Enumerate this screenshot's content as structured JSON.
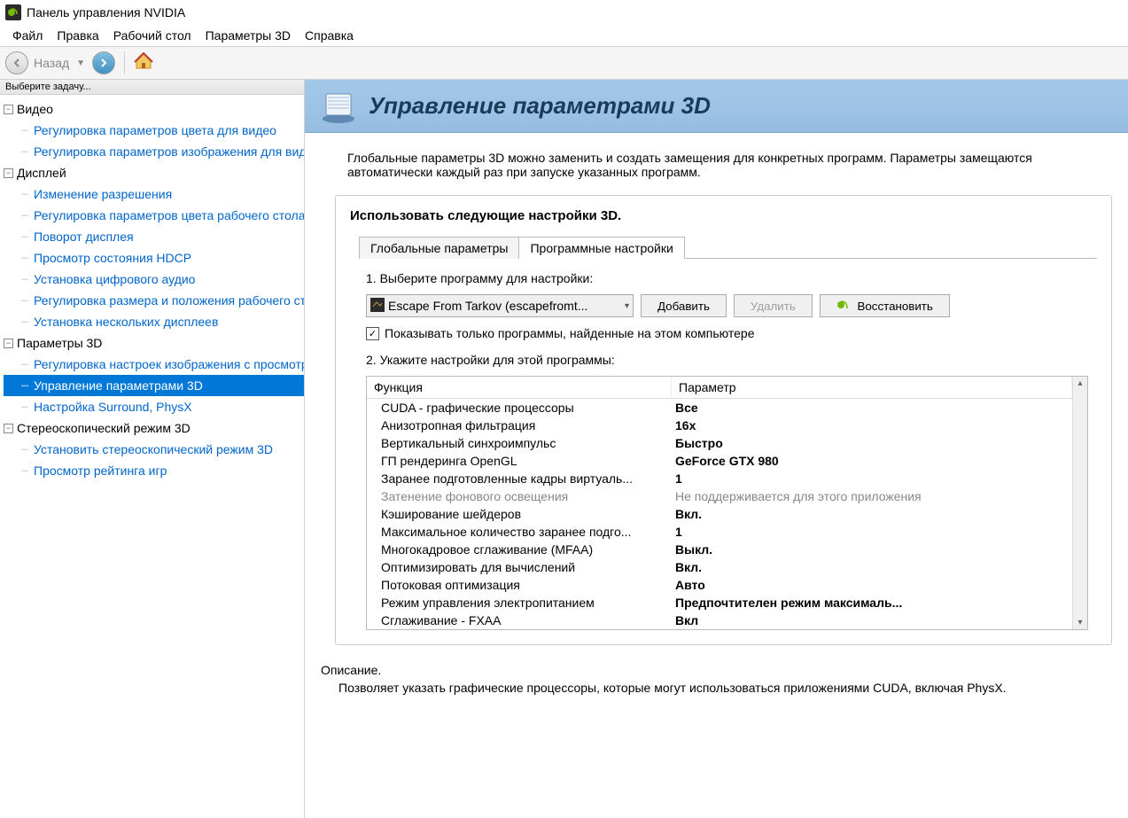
{
  "window": {
    "title": "Панель управления NVIDIA"
  },
  "menu": {
    "file": "Файл",
    "edit": "Правка",
    "desktop": "Рабочий стол",
    "params3d": "Параметры 3D",
    "help": "Справка"
  },
  "toolbar": {
    "back": "Назад"
  },
  "sidebar": {
    "task_header": "Выберите задачу...",
    "cats": [
      {
        "label": "Видео",
        "items": [
          "Регулировка параметров цвета для видео",
          "Регулировка параметров изображения для видео"
        ]
      },
      {
        "label": "Дисплей",
        "items": [
          "Изменение разрешения",
          "Регулировка параметров цвета рабочего стола",
          "Поворот дисплея",
          "Просмотр состояния HDCP",
          "Установка цифрового аудио",
          "Регулировка размера и положения рабочего стола",
          "Установка нескольких дисплеев"
        ]
      },
      {
        "label": "Параметры 3D",
        "items": [
          "Регулировка настроек изображения с просмотром",
          "Управление параметрами 3D",
          "Настройка Surround, PhysX"
        ],
        "selected": 1
      },
      {
        "label": "Стереоскопический режим 3D",
        "items": [
          "Установить стереоскопический режим 3D",
          "Просмотр рейтинга игр"
        ]
      }
    ]
  },
  "main": {
    "title": "Управление параметрами 3D",
    "intro": "Глобальные параметры 3D можно заменить и создать замещения для конкретных программ. Параметры замещаются автоматически каждый раз при запуске указанных программ.",
    "settings_title": "Использовать следующие настройки 3D.",
    "tabs": {
      "global": "Глобальные параметры",
      "program": "Программные настройки"
    },
    "step1": "1. Выберите программу для настройки:",
    "program_selected": "Escape From Tarkov (escapefromt...",
    "btn_add": "Добавить",
    "btn_remove": "Удалить",
    "btn_restore": "Восстановить",
    "show_only": "Показывать только программы, найденные на этом компьютере",
    "step2": "2. Укажите настройки для этой программы:",
    "col_func": "Функция",
    "col_param": "Параметр",
    "rows": [
      {
        "f": "CUDA - графические процессоры",
        "p": "Все"
      },
      {
        "f": "Анизотропная фильтрация",
        "p": "16x"
      },
      {
        "f": "Вертикальный синхроимпульс",
        "p": "Быстро"
      },
      {
        "f": "ГП рендеринга OpenGL",
        "p": "GeForce GTX 980"
      },
      {
        "f": "Заранее подготовленные кадры виртуаль...",
        "p": "1"
      },
      {
        "f": "Затенение фонового освещения",
        "p": "Не поддерживается для этого приложения",
        "disabled": true
      },
      {
        "f": "Кэширование шейдеров",
        "p": "Вкл."
      },
      {
        "f": "Максимальное количество заранее подго...",
        "p": "1"
      },
      {
        "f": "Многокадровое сглаживание (MFAA)",
        "p": "Выкл."
      },
      {
        "f": "Оптимизировать для вычислений",
        "p": "Вкл."
      },
      {
        "f": "Потоковая оптимизация",
        "p": "Авто"
      },
      {
        "f": "Режим управления электропитанием",
        "p": "Предпочтителен режим максималь..."
      },
      {
        "f": "Сглаживание - FXAA",
        "p": "Вкл"
      }
    ],
    "desc_title": "Описание.",
    "desc_body": "Позволяет указать графические процессоры, которые могут использоваться приложениями CUDA, включая PhysX."
  }
}
